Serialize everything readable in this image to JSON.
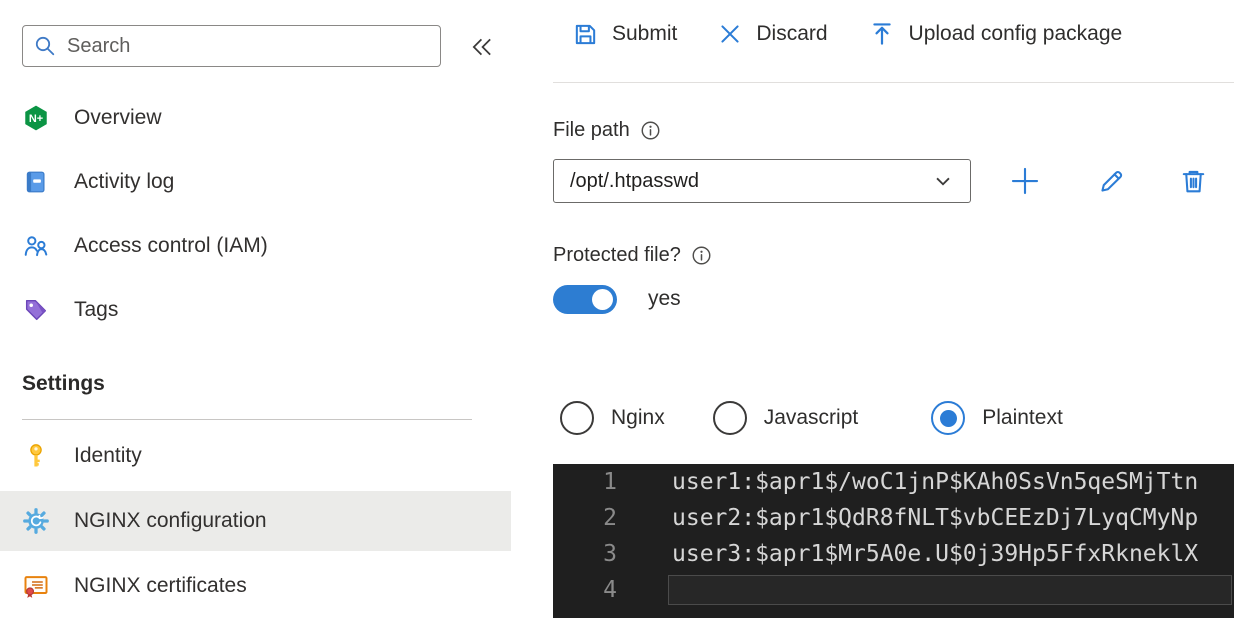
{
  "sidebar": {
    "search": {
      "placeholder": "Search"
    },
    "items": [
      {
        "label": "Overview",
        "icon": "nginx-logo-icon"
      },
      {
        "label": "Activity log",
        "icon": "activity-log-icon"
      },
      {
        "label": "Access control (IAM)",
        "icon": "access-control-icon"
      },
      {
        "label": "Tags",
        "icon": "tags-icon"
      }
    ],
    "settings_section": {
      "title": "Settings",
      "items": [
        {
          "label": "Identity",
          "icon": "key-icon",
          "selected": false
        },
        {
          "label": "NGINX configuration",
          "icon": "gear-icon",
          "selected": true
        },
        {
          "label": "NGINX certificates",
          "icon": "certificate-icon",
          "selected": false
        }
      ]
    }
  },
  "toolbar": {
    "submit_label": "Submit",
    "discard_label": "Discard",
    "upload_label": "Upload config package"
  },
  "form": {
    "file_path": {
      "label": "File path",
      "value": "/opt/.htpasswd"
    },
    "protected_file": {
      "label": "Protected file?",
      "state": "on",
      "value_label": "yes"
    },
    "format_options": [
      {
        "label": "Nginx",
        "selected": false
      },
      {
        "label": "Javascript",
        "selected": false
      },
      {
        "label": "Plaintext",
        "selected": true
      }
    ]
  },
  "editor": {
    "lines": [
      {
        "number": "1",
        "text": "user1:$apr1$/woC1jnP$KAh0SsVn5qeSMjTtn"
      },
      {
        "number": "2",
        "text": "user2:$apr1$QdR8fNLT$vbCEEzDj7LyqCMyNp"
      },
      {
        "number": "3",
        "text": "user3:$apr1$Mr5A0e.U$0j39Hp5FfxRkneklX"
      },
      {
        "number": "4",
        "text": "",
        "active": true
      }
    ]
  },
  "colors": {
    "accent": "#2b7cd6",
    "toggle_on": "#2d7dd2",
    "selected_row": "#ebebe9",
    "editor_bg": "#1f1f1f",
    "editor_text": "#d6d6d6",
    "editor_line_number": "#8a8a8a",
    "nginx_green": "#0b9444"
  }
}
